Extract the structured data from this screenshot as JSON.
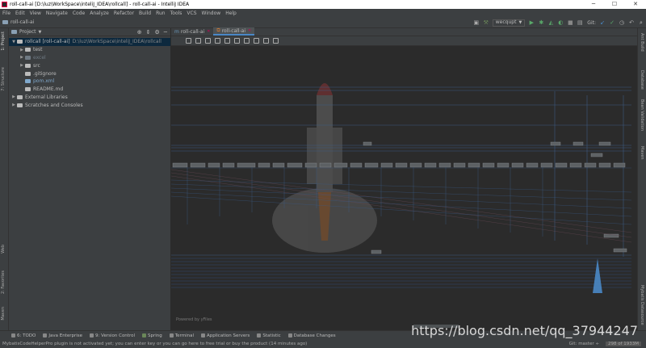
{
  "window": {
    "title": "roll-call-ai [D:\\luz\\WorkSpace\\inteliJ_IDEA\\rollcall] - roll-call-ai - IntelliJ IDEA",
    "minimize": "─",
    "maximize": "☐",
    "close": "✕"
  },
  "menu": [
    "File",
    "Edit",
    "View",
    "Navigate",
    "Code",
    "Analyze",
    "Refactor",
    "Build",
    "Run",
    "Tools",
    "VCS",
    "Window",
    "Help"
  ],
  "navbar": {
    "breadcrumb": "roll-call-ai",
    "run_config": "wecqupt",
    "git_label": "Git:"
  },
  "left_strip": {
    "project": "1: Project",
    "structure": "7: Structure",
    "web": "Web",
    "favorites": "2: Favorites",
    "maven_left": "Maven"
  },
  "right_strip": {
    "ant_build": "Ant Build",
    "database": "Database",
    "bean_validation": "Bean Validation",
    "maven": "Maven",
    "mybatis": "Mybatis Datasource"
  },
  "project_panel": {
    "title": "Project",
    "tree": [
      {
        "label": "rollcall [roll-call-ai]",
        "path": "D:\\luz\\WorkSpace\\inteliJ_IDEA\\rollcall",
        "depth": 0,
        "arrow": "▼",
        "color": "#bbbbbb"
      },
      {
        "label": "test",
        "path": "",
        "depth": 1,
        "arrow": "▶",
        "color": "#bbbbbb"
      },
      {
        "label": "excel",
        "path": "",
        "depth": 1,
        "arrow": "▶",
        "color": "#6f7a84"
      },
      {
        "label": "src",
        "path": "",
        "depth": 1,
        "arrow": "▶",
        "color": "#bbbbbb"
      },
      {
        "label": ".gitignore",
        "path": "",
        "depth": 1,
        "arrow": "",
        "color": "#bbbbbb"
      },
      {
        "label": "pom.xml",
        "path": "",
        "depth": 1,
        "arrow": "",
        "color": "#7fa8cc"
      },
      {
        "label": "README.md",
        "path": "",
        "depth": 1,
        "arrow": "",
        "color": "#bbbbbb"
      },
      {
        "label": "External Libraries",
        "path": "",
        "depth": 0,
        "arrow": "▶",
        "color": "#bbbbbb"
      },
      {
        "label": "Scratches and Consoles",
        "path": "",
        "depth": 0,
        "arrow": "▶",
        "color": "#bbbbbb"
      }
    ]
  },
  "editor": {
    "tabs": [
      {
        "label": "roll-call-ai",
        "active": false
      },
      {
        "label": "roll-call-ai",
        "active": true
      }
    ],
    "powered_by": "Powered by yFiles"
  },
  "bottom_tools": [
    "6: TODO",
    "Java Enterprise",
    "9: Version Control",
    "Spring",
    "Terminal",
    "Application Servers",
    "Statistic",
    "Database Changes"
  ],
  "status": {
    "message": "MybatisCodeHelperPro plugin is not activated yet; you can enter key or you can go here to free trial or buy the product (14 minutes ago)",
    "git": "Git: master ÷",
    "memory": "298 of 1933M"
  },
  "watermark": "https://blog.csdn.net/qq_37944247",
  "colors": {
    "accent": "#4a88c7",
    "background": "#2b2b2b",
    "panel": "#3c3f41"
  }
}
